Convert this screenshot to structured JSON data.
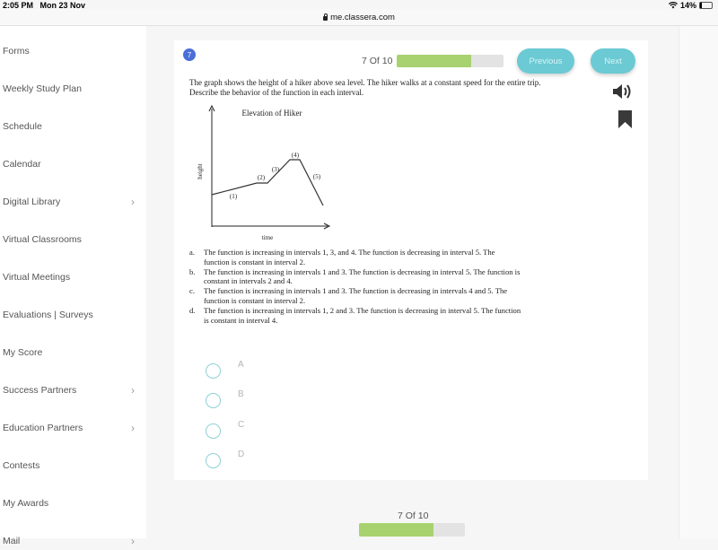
{
  "status_bar": {
    "time": "2:05 PM",
    "date": "Mon 23 Nov",
    "battery": "14%",
    "icons": [
      "wifi-icon",
      "battery-icon"
    ]
  },
  "url_bar": {
    "url": "me.classera.com",
    "icon": "lock-icon"
  },
  "sidebar": {
    "items": [
      {
        "label": "Forms",
        "has_chevron": false
      },
      {
        "label": "Weekly Study Plan",
        "has_chevron": false
      },
      {
        "label": "Schedule",
        "has_chevron": false
      },
      {
        "label": "Calendar",
        "has_chevron": false
      },
      {
        "label": "Digital Library",
        "has_chevron": true
      },
      {
        "label": "Virtual Classrooms",
        "has_chevron": false
      },
      {
        "label": "Virtual Meetings",
        "has_chevron": false
      },
      {
        "label": "Evaluations | Surveys",
        "has_chevron": false
      },
      {
        "label": "My Score",
        "has_chevron": false
      },
      {
        "label": "Success Partners",
        "has_chevron": true
      },
      {
        "label": "Education Partners",
        "has_chevron": true
      },
      {
        "label": "Contests",
        "has_chevron": false
      },
      {
        "label": "My Awards",
        "has_chevron": false
      },
      {
        "label": "Mail",
        "has_chevron": true
      }
    ],
    "chevron_glyph": "›"
  },
  "question": {
    "number": "7",
    "progress_label": "7 Of 10",
    "progress_fraction": 0.7,
    "previous_label": "Previous",
    "next_label": "Next",
    "text": "The graph shows the height of a hiker above sea level. The hiker walks at a constant speed for the entire trip. Describe the behavior of the function in each interval.",
    "graph": {
      "title": "Elevation of Hiker",
      "xlabel": "time",
      "ylabel": "height",
      "interval_labels": [
        "(1)",
        "(2)",
        "(3)",
        "(4)",
        "(5)"
      ]
    },
    "choices": [
      {
        "label": "a.",
        "text": "The function is increasing in intervals 1, 3, and 4. The function is decreasing in interval 5. The function is constant in interval 2."
      },
      {
        "label": "b.",
        "text": "The function is increasing in intervals 1 and 3. The function is decreasing in interval 5. The function is constant in intervals 2 and 4."
      },
      {
        "label": "c.",
        "text": "The function is increasing in intervals 1 and 3. The function is decreasing in intervals 4 and 5. The function is constant in interval 2."
      },
      {
        "label": "d.",
        "text": "The function is increasing in intervals 1, 2 and 3. The function is decreasing in interval 5. The function is constant in interval 4."
      }
    ],
    "options": [
      "A",
      "B",
      "C",
      "D"
    ],
    "accent_color": "#6bcad4",
    "progress_color": "#a8d26f"
  },
  "bottom_progress": {
    "label": "7 Of 10",
    "fraction": 0.7
  }
}
